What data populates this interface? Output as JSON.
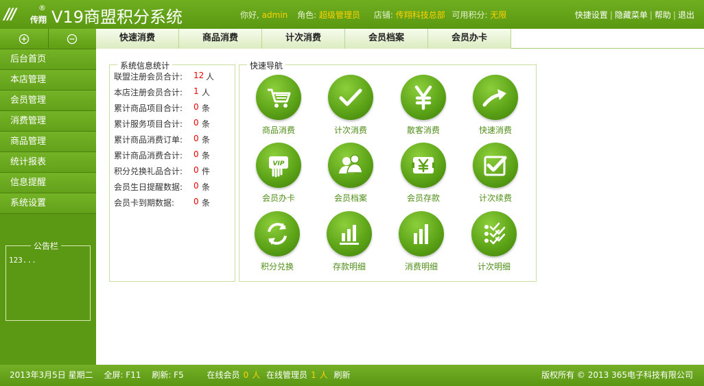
{
  "header": {
    "logo_text": "传翔",
    "logo_reg": "®",
    "title": "V19商盟积分系统",
    "greeting_label": "你好,",
    "user": "admin",
    "role_label": "角色:",
    "role": "超级管理员",
    "store_label": "店铺:",
    "store": "传翔科技总部",
    "points_label": "可用积分:",
    "points": "无限",
    "menu": [
      "快捷设置",
      "隐藏菜单",
      "帮助",
      "退出"
    ]
  },
  "sidebar": {
    "expand_icon": "plus-circle-icon",
    "collapse_icon": "minus-circle-icon",
    "items": [
      "后台首页",
      "本店管理",
      "会员管理",
      "消费管理",
      "商品管理",
      "统计报表",
      "信息提醒",
      "系统设置"
    ],
    "notice_title": "公告栏",
    "notice_text": "123..."
  },
  "tabs": [
    "快速消费",
    "商品消费",
    "计次消费",
    "会员档案",
    "会员办卡"
  ],
  "stats": {
    "title": "系统信息统计",
    "rows": [
      {
        "label": "联盟注册会员合计:",
        "value": "12",
        "unit": "人"
      },
      {
        "label": "本店注册会员合计:",
        "value": "1",
        "unit": "人"
      },
      {
        "label": "累计商品项目合计:",
        "value": "0",
        "unit": "条"
      },
      {
        "label": "累计服务项目合计:",
        "value": "0",
        "unit": "条"
      },
      {
        "label": "累计商品消费订单:",
        "value": "0",
        "unit": "条"
      },
      {
        "label": "累计商品消费合计:",
        "value": "0",
        "unit": "条"
      },
      {
        "label": "积分兑换礼品合计:",
        "value": "0",
        "unit": "件"
      },
      {
        "label": "会员生日提醒数据:",
        "value": "0",
        "unit": "条"
      },
      {
        "label": "会员卡到期数据:",
        "value": "0",
        "unit": "条"
      }
    ]
  },
  "quicknav": {
    "title": "快速导航",
    "items": [
      {
        "label": "商品消费",
        "icon": "cart-icon"
      },
      {
        "label": "计次消费",
        "icon": "checkmark-icon"
      },
      {
        "label": "散客消费",
        "icon": "yen-icon"
      },
      {
        "label": "快速消费",
        "icon": "arrow-up-right-icon"
      },
      {
        "label": "会员办卡",
        "icon": "vip-card-icon"
      },
      {
        "label": "会员档案",
        "icon": "users-icon"
      },
      {
        "label": "会员存款",
        "icon": "yen-wallet-icon"
      },
      {
        "label": "计次续费",
        "icon": "checkbox-icon"
      },
      {
        "label": "积分兑换",
        "icon": "refresh-icon"
      },
      {
        "label": "存款明细",
        "icon": "bar-chart-icon"
      },
      {
        "label": "消费明细",
        "icon": "bar-chart-icon"
      },
      {
        "label": "计次明细",
        "icon": "checklist-icon"
      }
    ]
  },
  "footer": {
    "date": "2013年3月5日 星期二",
    "fullscreen": "全屏: F11",
    "refresh_key": "刷新: F5",
    "online_members_label": "在线会员",
    "online_members": "0",
    "person_unit": "人",
    "online_admins_label": "在线管理员",
    "online_admins": "1",
    "refresh_label": "刷新",
    "copyright": "版权所有 © 2013 365电子科技有限公司"
  }
}
